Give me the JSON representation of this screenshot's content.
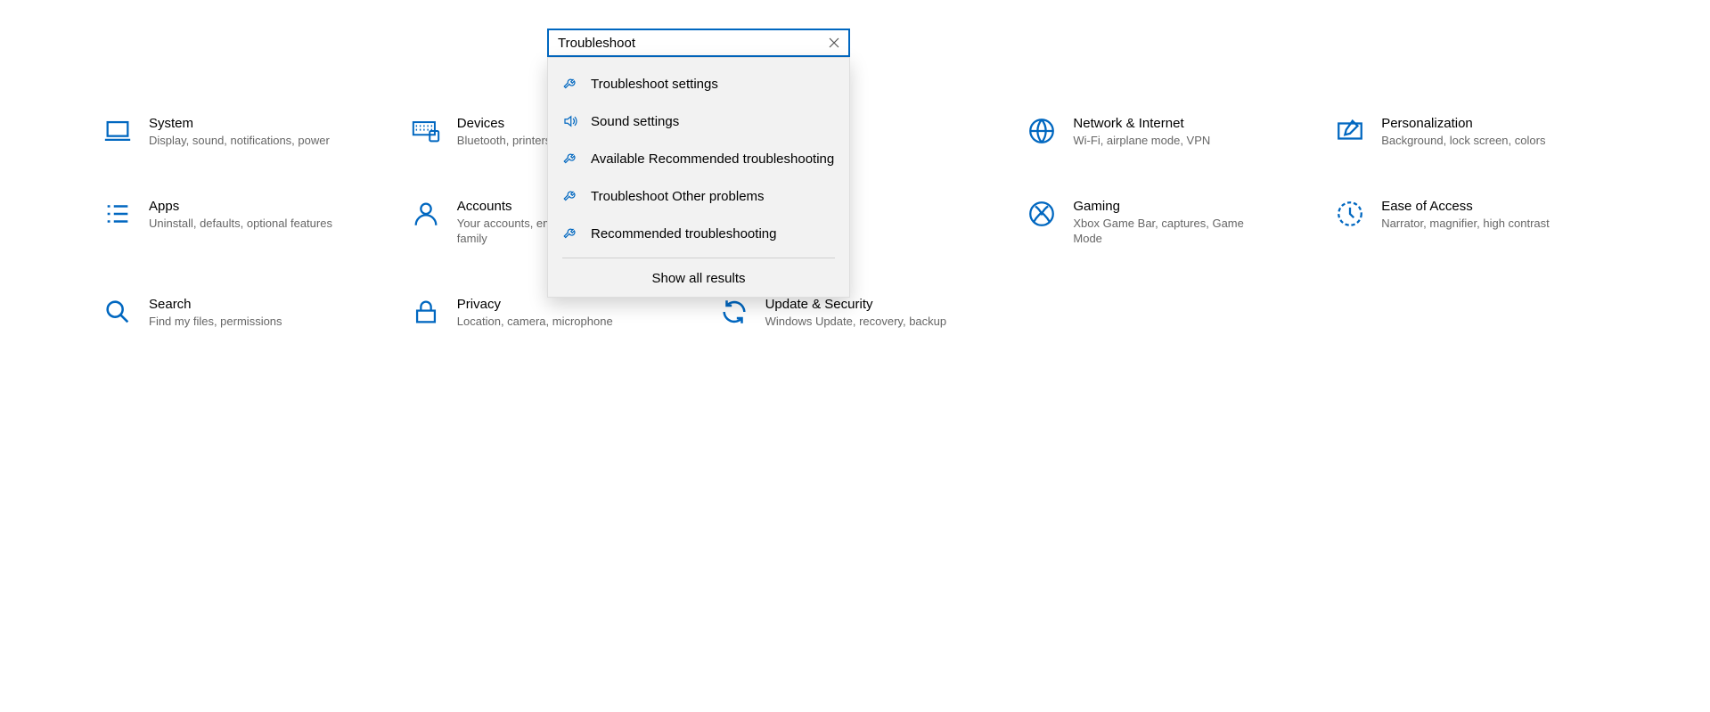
{
  "search": {
    "value": "Troubleshoot",
    "clear_title": "Clear"
  },
  "suggestions": [
    {
      "icon": "wrench-icon",
      "label": "Troubleshoot settings"
    },
    {
      "icon": "speaker-icon",
      "label": "Sound settings"
    },
    {
      "icon": "wrench-icon",
      "label": "Available Recommended troubleshooting"
    },
    {
      "icon": "wrench-icon",
      "label": "Troubleshoot Other problems"
    },
    {
      "icon": "wrench-icon",
      "label": "Recommended troubleshooting"
    }
  ],
  "show_all": "Show all results",
  "categories": {
    "system": {
      "title": "System",
      "sub": "Display, sound, notifications, power"
    },
    "devices": {
      "title": "Devices",
      "sub": "Bluetooth, printers, mouse"
    },
    "network": {
      "title": "Network & Internet",
      "sub": "Wi-Fi, airplane mode, VPN"
    },
    "personalization": {
      "title": "Personalization",
      "sub": "Background, lock screen, colors"
    },
    "apps": {
      "title": "Apps",
      "sub": "Uninstall, defaults, optional features"
    },
    "accounts": {
      "title": "Accounts",
      "sub": "Your accounts, email, sync, work, family"
    },
    "gaming": {
      "title": "Gaming",
      "sub": "Xbox Game Bar, captures, Game Mode"
    },
    "ease": {
      "title": "Ease of Access",
      "sub": "Narrator, magnifier, high contrast"
    },
    "search_cat": {
      "title": "Search",
      "sub": "Find my files, permissions"
    },
    "privacy": {
      "title": "Privacy",
      "sub": "Location, camera, microphone"
    },
    "update": {
      "title": "Update & Security",
      "sub": "Windows Update, recovery, backup"
    }
  },
  "colors": {
    "accent": "#0067c0"
  }
}
